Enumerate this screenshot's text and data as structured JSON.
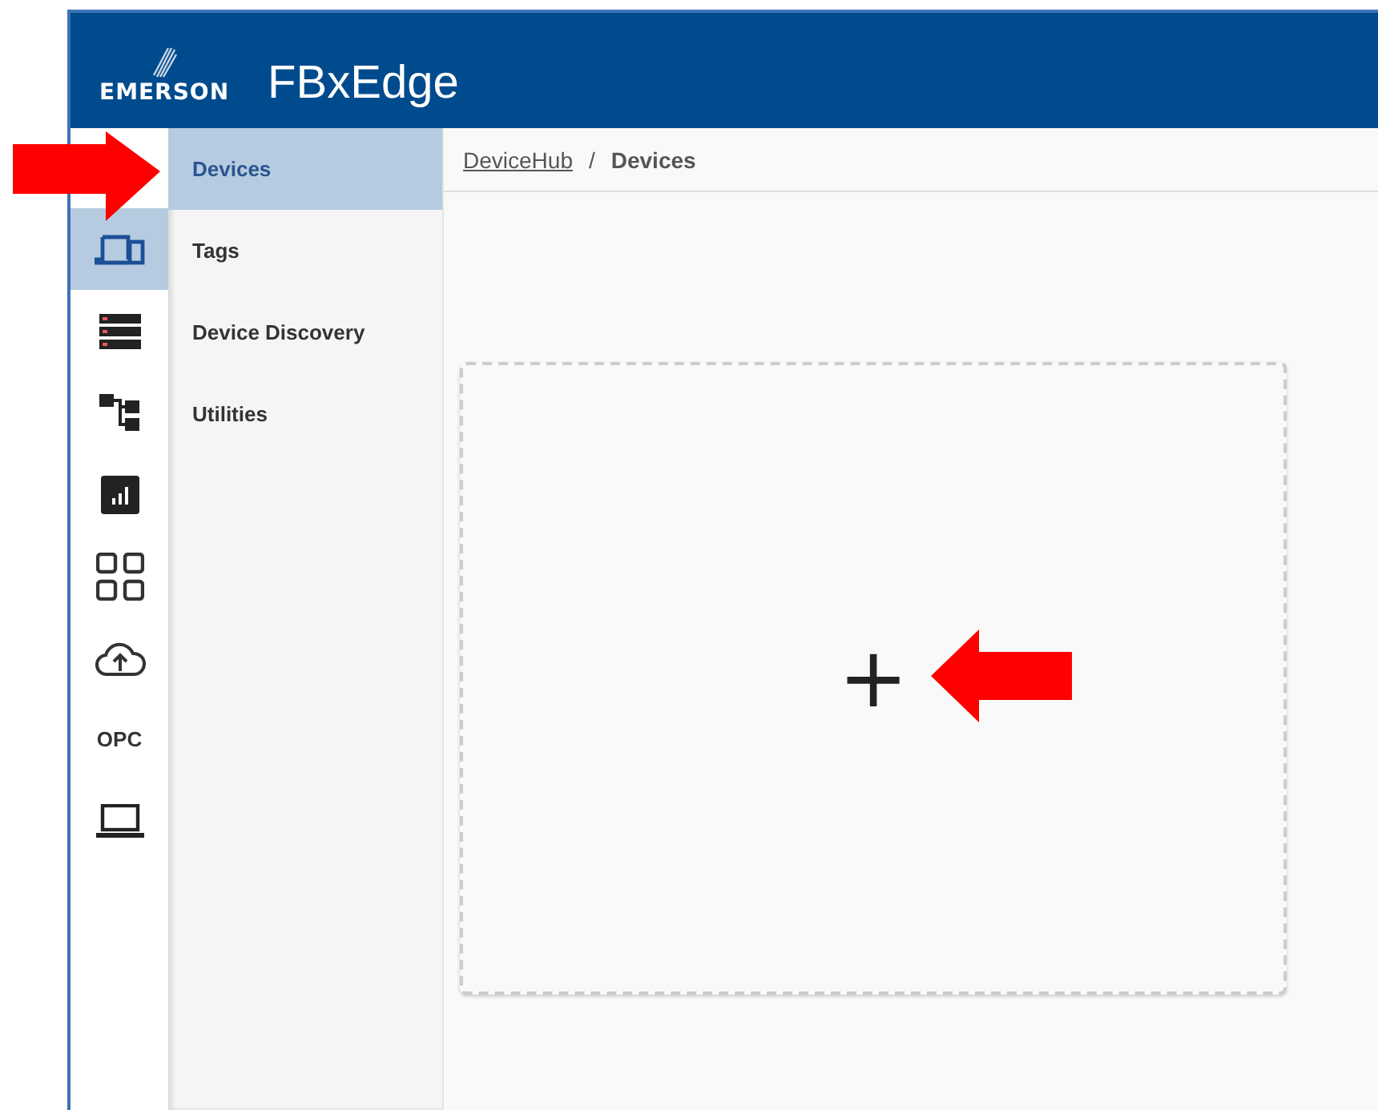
{
  "header": {
    "brand": "EMERSON",
    "title": "FBxEdge"
  },
  "rail": [
    {
      "kind": "devices",
      "selected": true
    },
    {
      "kind": "server",
      "selected": false
    },
    {
      "kind": "tree",
      "selected": false
    },
    {
      "kind": "chart",
      "selected": false
    },
    {
      "kind": "grid",
      "selected": false
    },
    {
      "kind": "cloud",
      "selected": false
    },
    {
      "kind": "text",
      "label": "OPC",
      "selected": false
    },
    {
      "kind": "laptop",
      "selected": false
    }
  ],
  "submenu": [
    {
      "label": "Devices",
      "selected": true
    },
    {
      "label": "Tags",
      "selected": false
    },
    {
      "label": "Device Discovery",
      "selected": false
    },
    {
      "label": "Utilities",
      "selected": false
    }
  ],
  "breadcrumb": {
    "link": "DeviceHub",
    "separator": "/",
    "current": "Devices"
  },
  "add_card": {
    "symbol": "+"
  },
  "annotations": [
    {
      "kind": "arrow-right"
    },
    {
      "kind": "arrow-left"
    }
  ]
}
